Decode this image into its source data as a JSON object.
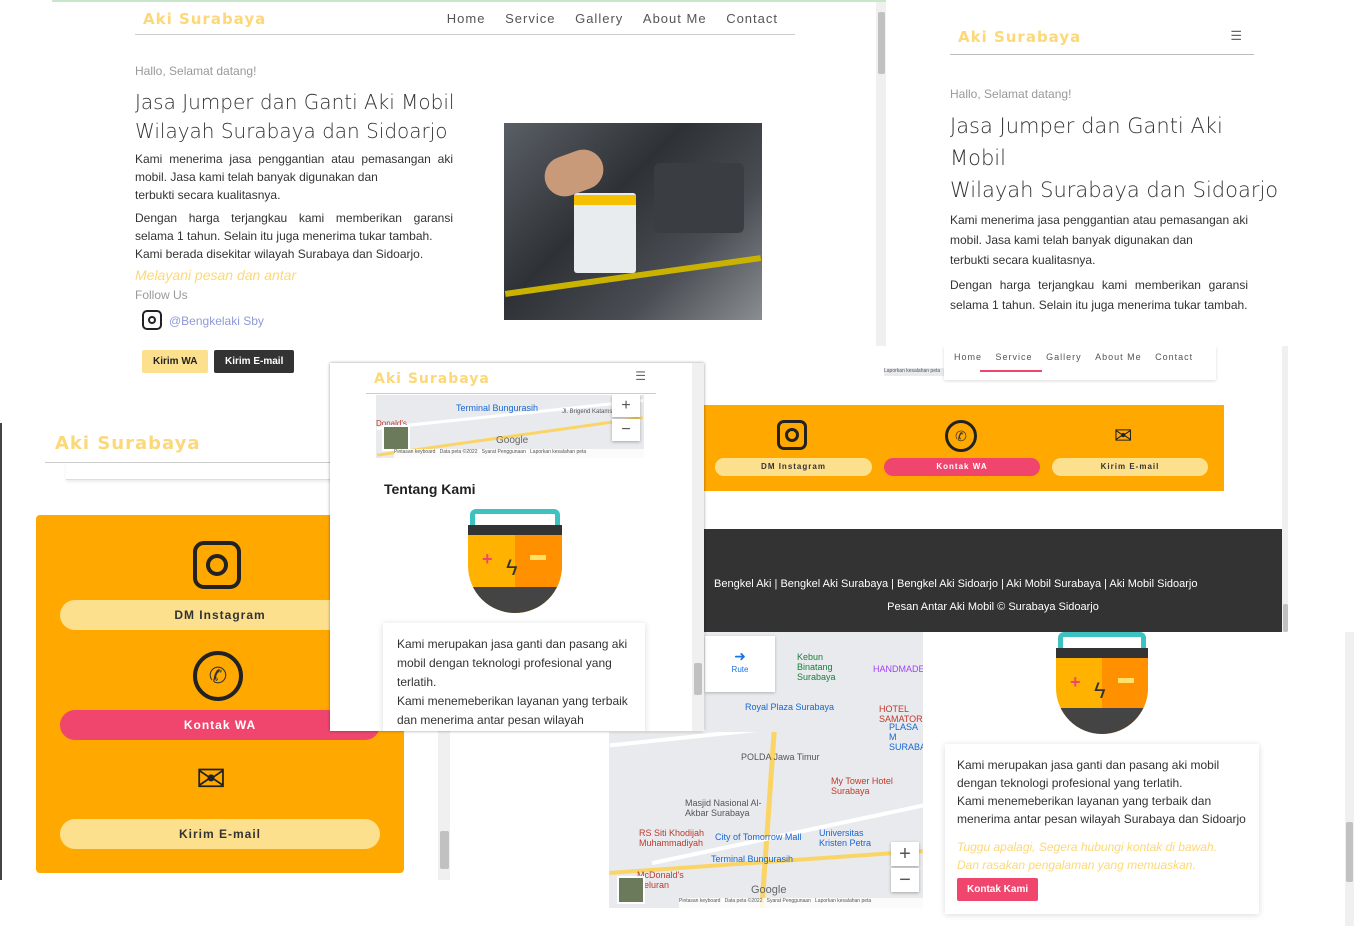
{
  "colors": {
    "brand": "#fdd878",
    "orange": "#ffa800",
    "wa": "#f0466e",
    "dark": "#333333",
    "pale": "#fde08e"
  },
  "brand": "Aki Surabaya",
  "nav": {
    "items": [
      "Home",
      "Service",
      "Gallery",
      "About Me",
      "Contact"
    ]
  },
  "hero": {
    "greeting": "Hallo, Selamat datang!",
    "title_line1": "Jasa Jumper dan Ganti Aki Mobil",
    "title_line2": "Wilayah Surabaya dan Sidoarjo",
    "mobile_title_1": "Jasa Jumper dan Ganti Aki",
    "mobile_title_2": "Mobil",
    "mobile_title_3": "Wilayah Surabaya dan Sidoarjo",
    "p1a": "Kami menerima jasa penggantian atau pemasangan aki mobil. Jasa kami telah banyak digunakan dan",
    "p1b": "terbukti secara kualitasnya.",
    "p2": "Dengan harga terjangkau kami memberikan garansi selama 1 tahun. Selain itu juga menerima tukar tambah.",
    "p2_mobile": "Dengan harga terjangkau kami memberikan garansi selama 1 tahun. Selain itu juga menerima tukar tambah.",
    "p3": "Kami berada disekitar wilayah Surabaya dan Sidoarjo.",
    "tagline": "Melayani pesan dan antar",
    "follow": "Follow Us",
    "handle": "@Bengkelaki Sby",
    "btn_wa": "Kirim WA",
    "btn_email": "Kirim E-mail"
  },
  "contact": {
    "dm": "DM Instagram",
    "wa": "Kontak WA",
    "email": "Kirim E-mail"
  },
  "about": {
    "title": "Tentang Kami",
    "text1": "Kami merupakan jasa ganti dan pasang aki mobil dengan teknologi profesional yang terlatih.",
    "text2": "Kami menemeberikan layanan yang terbaik dan menerima antar pesan wilayah Surabaya dan Sidoarjo",
    "cta1": "Tuggu apalagi, Segera hubungi kontak di bawah.",
    "cta2": "Dan rasakan pengalaman yang memuaskan.",
    "btn": "Kontak Kami"
  },
  "footer": {
    "line1": "Bengkel Aki | Bengkel Aki Surabaya | Bengkel Aki Sidoarjo | Aki Mobil Surabaya | Aki Mobil Sidoarjo",
    "line2": "Pesan Antar Aki Mobil © Surabaya Sidoarjo"
  },
  "map": {
    "google": "Google",
    "shortcuts": "Pintasan keyboard",
    "mapdata": "Data peta ©2022",
    "terms": "Syarat Penggunaan",
    "report": "Laporkan kesalahan peta",
    "route": "Rute",
    "pois": [
      "Terminal Bungurasih",
      "Kebun Binatang Surabaya",
      "HANDMADE",
      "HOTEL SAMATOR",
      "Royal Plaza Surabaya",
      "PLASA M SURABA",
      "POLDA Jawa Timur",
      "My Tower Hotel Surabaya",
      "Masjid Nasional Al-Akbar Surabaya",
      "RS Siti Khodijah Muhammadiyah",
      "City of Tomorrow Mall",
      "Universitas Kristen Petra",
      "Terminal Bungurasih",
      "McDonald's Geluran",
      "Jl. Brigend Katamso",
      "Donald's"
    ]
  }
}
